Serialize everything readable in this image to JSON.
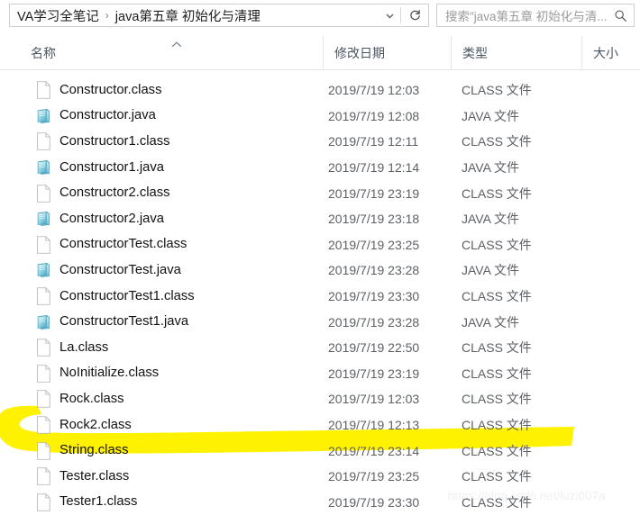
{
  "addressbar": {
    "breadcrumb_root": "VA学习全笔记",
    "breadcrumb_separator": "›",
    "breadcrumb_current": "java第五章 初始化与清理",
    "dropdown_icon": "chevron-down-icon",
    "refresh_icon": "refresh-icon",
    "search_placeholder": "搜索\"java第五章 初始化与清...",
    "search_icon": "search-icon"
  },
  "columns": {
    "name": "名称",
    "date": "修改日期",
    "type": "类型",
    "size": "大小",
    "sort_icon": "sort-ascending-chevron-icon"
  },
  "types": {
    "class": "CLASS 文件",
    "java": "JAVA 文件"
  },
  "files": [
    {
      "name": "Constructor.class",
      "date": "2019/7/19 12:03",
      "type": "CLASS 文件",
      "size": "",
      "icon": "generic-file-icon",
      "highlighted": false
    },
    {
      "name": "Constructor.java",
      "date": "2019/7/19 12:08",
      "type": "JAVA 文件",
      "size": "",
      "icon": "java-file-icon",
      "highlighted": false
    },
    {
      "name": "Constructor1.class",
      "date": "2019/7/19 12:11",
      "type": "CLASS 文件",
      "size": "",
      "icon": "generic-file-icon",
      "highlighted": false
    },
    {
      "name": "Constructor1.java",
      "date": "2019/7/19 12:14",
      "type": "JAVA 文件",
      "size": "",
      "icon": "java-file-icon",
      "highlighted": false
    },
    {
      "name": "Constructor2.class",
      "date": "2019/7/19 23:19",
      "type": "CLASS 文件",
      "size": "",
      "icon": "generic-file-icon",
      "highlighted": false
    },
    {
      "name": "Constructor2.java",
      "date": "2019/7/19 23:18",
      "type": "JAVA 文件",
      "size": "",
      "icon": "java-file-icon",
      "highlighted": false
    },
    {
      "name": "ConstructorTest.class",
      "date": "2019/7/19 23:25",
      "type": "CLASS 文件",
      "size": "",
      "icon": "generic-file-icon",
      "highlighted": false
    },
    {
      "name": "ConstructorTest.java",
      "date": "2019/7/19 23:28",
      "type": "JAVA 文件",
      "size": "",
      "icon": "java-file-icon",
      "highlighted": false
    },
    {
      "name": "ConstructorTest1.class",
      "date": "2019/7/19 23:30",
      "type": "CLASS 文件",
      "size": "",
      "icon": "generic-file-icon",
      "highlighted": false
    },
    {
      "name": "ConstructorTest1.java",
      "date": "2019/7/19 23:28",
      "type": "JAVA 文件",
      "size": "",
      "icon": "java-file-icon",
      "highlighted": false
    },
    {
      "name": "La.class",
      "date": "2019/7/19 22:50",
      "type": "CLASS 文件",
      "size": "",
      "icon": "generic-file-icon",
      "highlighted": false
    },
    {
      "name": "NoInitialize.class",
      "date": "2019/7/19 23:19",
      "type": "CLASS 文件",
      "size": "",
      "icon": "generic-file-icon",
      "highlighted": false
    },
    {
      "name": "Rock.class",
      "date": "2019/7/19 12:03",
      "type": "CLASS 文件",
      "size": "",
      "icon": "generic-file-icon",
      "highlighted": false
    },
    {
      "name": "Rock2.class",
      "date": "2019/7/19 12:13",
      "type": "CLASS 文件",
      "size": "",
      "icon": "generic-file-icon",
      "highlighted": false
    },
    {
      "name": "String.class",
      "date": "2019/7/19 23:14",
      "type": "CLASS 文件",
      "size": "",
      "icon": "generic-file-icon",
      "highlighted": true
    },
    {
      "name": "Tester.class",
      "date": "2019/7/19 23:25",
      "type": "CLASS 文件",
      "size": "",
      "icon": "generic-file-icon",
      "highlighted": false
    },
    {
      "name": "Tester1.class",
      "date": "2019/7/19 23:30",
      "type": "CLASS 文件",
      "size": "",
      "icon": "generic-file-icon",
      "highlighted": false
    }
  ],
  "annotation": {
    "marker_color": "#FFF200",
    "target_row": "String.class"
  },
  "watermark": {
    "text": "https://blog.csdn.net/luzi007a"
  }
}
